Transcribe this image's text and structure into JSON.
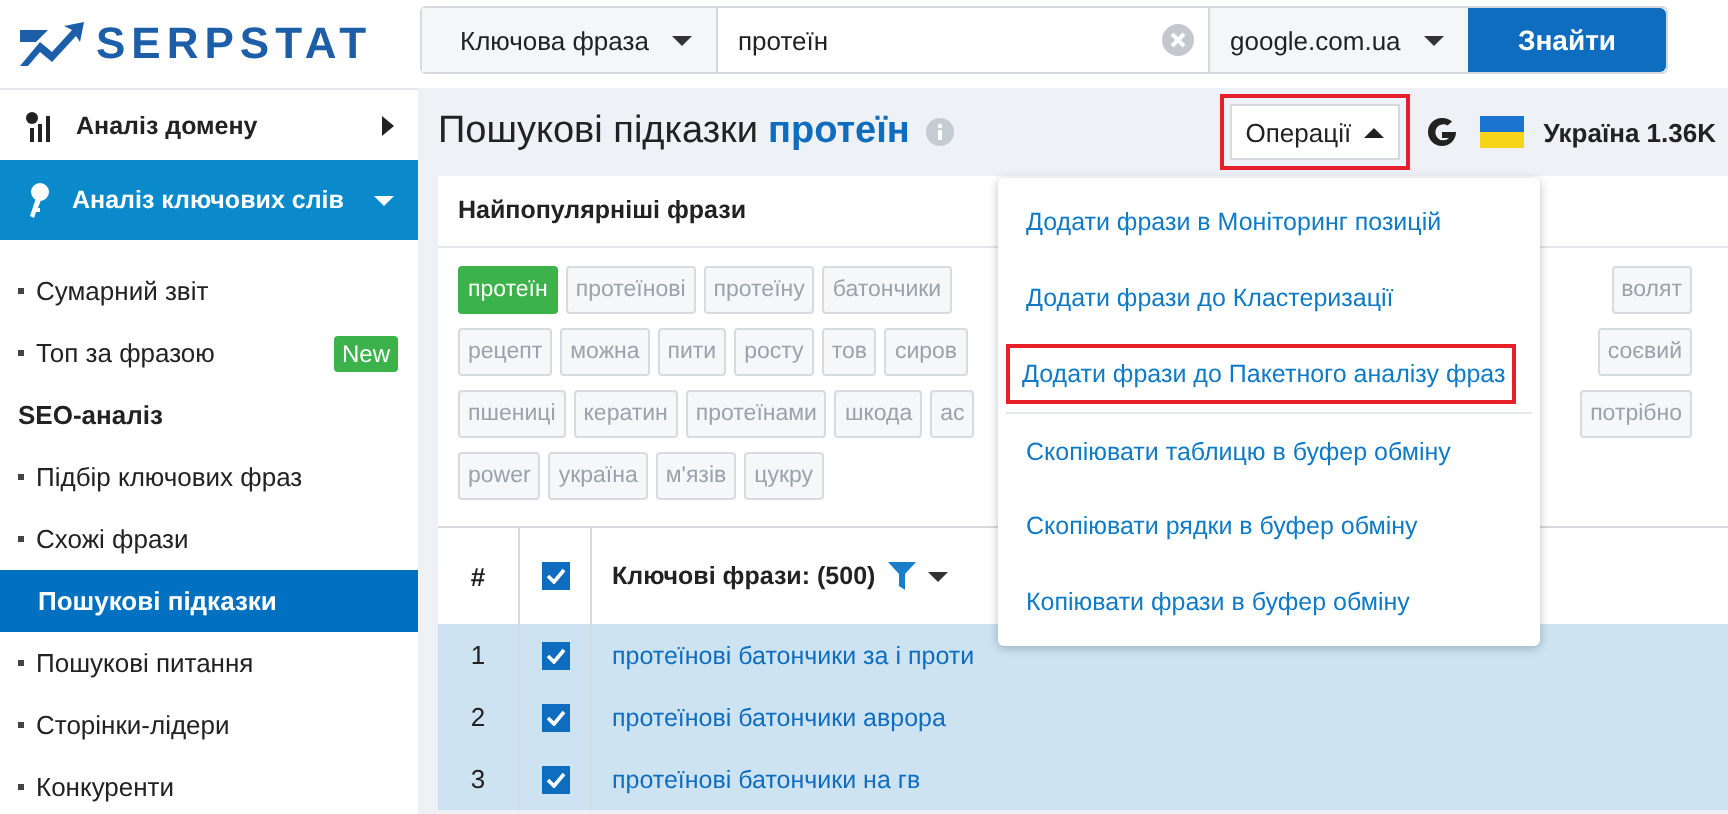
{
  "logo": {
    "text": "SERPSTAT"
  },
  "search": {
    "type": "Ключова фраза",
    "query": "протеїн",
    "engine": "google.com.ua",
    "button": "Знайти"
  },
  "sidebar": {
    "items": [
      {
        "kind": "group",
        "label": "Аналіз домену",
        "expanded": false,
        "selected": false
      },
      {
        "kind": "group",
        "label": "Аналіз ключових слів",
        "expanded": true,
        "selected": true
      },
      {
        "kind": "link",
        "label": "Сумарний звіт",
        "selected": false
      },
      {
        "kind": "link",
        "label": "Топ за фразою",
        "selected": false,
        "badge": "New"
      },
      {
        "kind": "heading",
        "label": "SEO-аналіз"
      },
      {
        "kind": "link",
        "label": "Підбір ключових фраз",
        "selected": false
      },
      {
        "kind": "link",
        "label": "Схожі фрази",
        "selected": false
      },
      {
        "kind": "link",
        "label": "Пошукові підказки",
        "selected": true
      },
      {
        "kind": "link",
        "label": "Пошукові питання",
        "selected": false
      },
      {
        "kind": "link",
        "label": "Сторінки-лідери",
        "selected": false
      },
      {
        "kind": "link",
        "label": "Конкуренти",
        "selected": false
      }
    ]
  },
  "header": {
    "title": "Пошукові підказки",
    "keyword": "протеїн",
    "operations": {
      "label": "Операції",
      "open": true,
      "highlighted": true
    },
    "region": "Україна 1.36K"
  },
  "popular": {
    "title": "Найпопулярніші фрази",
    "tag_rows": [
      {
        "left": [
          {
            "label": "протеїн",
            "selected": true
          },
          {
            "label": "протеїнові",
            "selected": false
          },
          {
            "label": "протеїну",
            "selected": false
          },
          {
            "label": "батончики",
            "selected": false
          }
        ],
        "right": [
          {
            "label": "волят",
            "selected": false
          }
        ]
      },
      {
        "left": [
          {
            "label": "рецепт",
            "selected": false
          },
          {
            "label": "можна",
            "selected": false
          },
          {
            "label": "пити",
            "selected": false
          },
          {
            "label": "росту",
            "selected": false
          },
          {
            "label": "тов",
            "selected": false
          },
          {
            "label": "сиров",
            "selected": false
          }
        ],
        "right": [
          {
            "label": "соєвий",
            "selected": false
          }
        ]
      },
      {
        "left": [
          {
            "label": "пшениці",
            "selected": false
          },
          {
            "label": "кератин",
            "selected": false
          },
          {
            "label": "протеїнами",
            "selected": false
          },
          {
            "label": "шкода",
            "selected": false
          },
          {
            "label": "ас",
            "selected": false
          }
        ],
        "right": [
          {
            "label": "потрібно",
            "selected": false
          }
        ]
      },
      {
        "left": [
          {
            "label": "power",
            "selected": false
          },
          {
            "label": "україна",
            "selected": false
          },
          {
            "label": "м'язів",
            "selected": false
          },
          {
            "label": "цукру",
            "selected": false
          }
        ],
        "right": []
      }
    ]
  },
  "operations_menu": [
    {
      "label": "Додати фрази в Моніторинг позицій",
      "highlighted": false,
      "divider_before": false
    },
    {
      "label": "Додати фрази до Кластеризації",
      "highlighted": false,
      "divider_before": false
    },
    {
      "label": "Додати фрази до Пакетного аналізу фраз",
      "highlighted": true,
      "divider_before": false
    },
    {
      "label": "Скопіювати таблицю в буфер обміну",
      "highlighted": false,
      "divider_before": true
    },
    {
      "label": "Скопіювати рядки в буфер обміну",
      "highlighted": false,
      "divider_before": false
    },
    {
      "label": "Копіювати фрази в буфер обміну",
      "highlighted": false,
      "divider_before": false
    }
  ],
  "table": {
    "columns": [
      "#",
      "Ключові фрази: (500)"
    ],
    "header_checked": true,
    "rows": [
      {
        "num": "1",
        "phrase": "протеїнові батончики за і проти",
        "checked": true,
        "selected": true
      },
      {
        "num": "2",
        "phrase": "протеїнові батончики аврора",
        "checked": true,
        "selected": true
      },
      {
        "num": "3",
        "phrase": "протеїнові батончики на гв",
        "checked": true,
        "selected": true
      }
    ]
  }
}
